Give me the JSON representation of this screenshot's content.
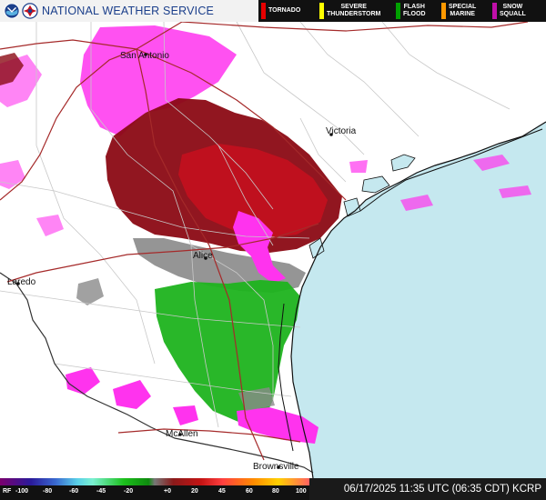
{
  "header": {
    "title": "NATIONAL WEATHER SERVICE",
    "logos": [
      "noaa-logo",
      "nws-logo"
    ]
  },
  "legend": [
    {
      "label": "TORNADO",
      "color": "#e60000"
    },
    {
      "label": "SEVERE\nTHUNDERSTORM",
      "color": "#ffff00"
    },
    {
      "label": "FLASH\nFLOOD",
      "color": "#00a000"
    },
    {
      "label": "SPECIAL\nMARINE",
      "color": "#ff9900"
    },
    {
      "label": "SNOW\nSQUALL",
      "color": "#c00fa8"
    }
  ],
  "cities": {
    "san_antonio": "San Antonio",
    "victoria": "Victoria",
    "alice": "Alice",
    "laredo": "Laredo",
    "mcallen": "McAllen",
    "brownsville": "Brownsville"
  },
  "scale": {
    "prefix": "RF",
    "ticks": [
      "-100",
      "-80",
      "-60",
      "-45",
      "-20",
      "+0",
      "20",
      "45",
      "60",
      "80",
      "100"
    ]
  },
  "timestamp": "06/17/2025 11:35 UTC (06:35 CDT) KCRP",
  "colors": {
    "gulf": "#c5e8ef",
    "land": "#ffffff",
    "county_lines": "#c8c8c8",
    "state_line": "#333333",
    "highways": "#a52a2a",
    "coastline": "#111111",
    "radar_magenta": "#ff33ee",
    "radar_dark_red": "#8b0a14",
    "radar_red": "#c4101e",
    "radar_green": "#1db31d",
    "radar_gray": "#8a8a8a"
  }
}
